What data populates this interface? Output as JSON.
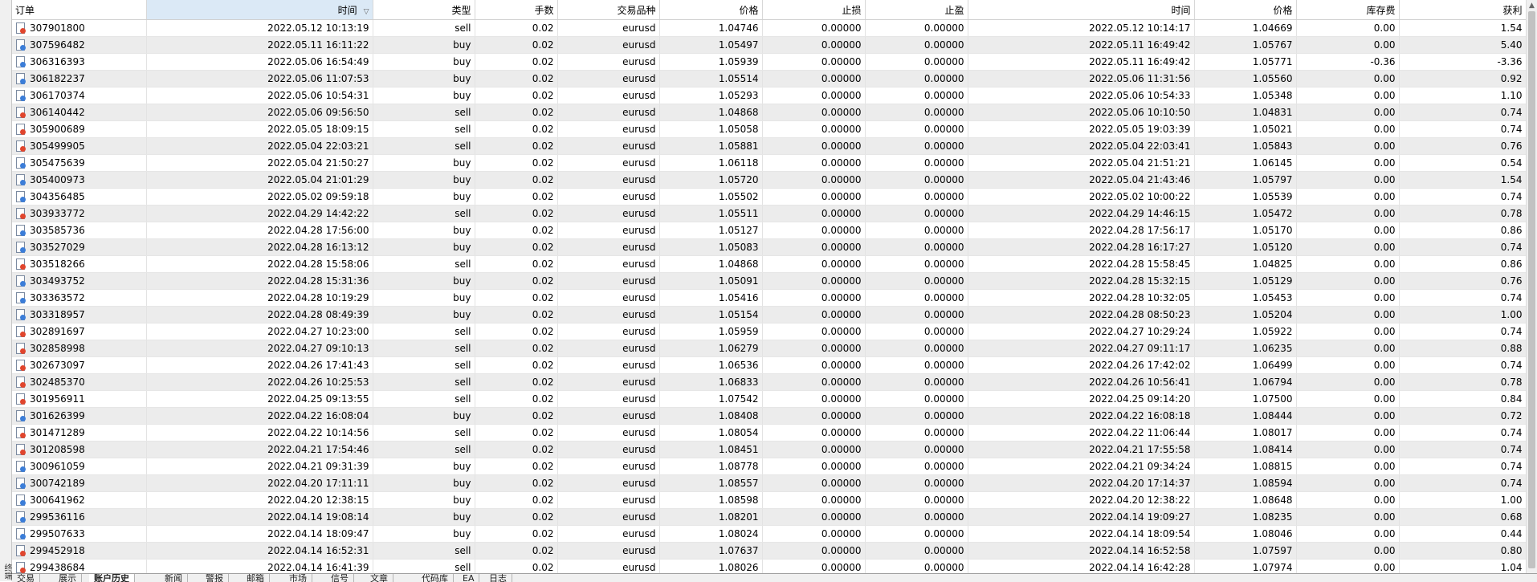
{
  "leftstrip_label": "终端",
  "columns": [
    {
      "key": "order",
      "label": "订单",
      "align": "l"
    },
    {
      "key": "open_time",
      "label": "时间",
      "align": "r",
      "sorted": true
    },
    {
      "key": "type",
      "label": "类型",
      "align": "r"
    },
    {
      "key": "volume",
      "label": "手数",
      "align": "r"
    },
    {
      "key": "symbol",
      "label": "交易品种",
      "align": "r"
    },
    {
      "key": "open_price",
      "label": "价格",
      "align": "r"
    },
    {
      "key": "sl",
      "label": "止损",
      "align": "r"
    },
    {
      "key": "tp",
      "label": "止盈",
      "align": "r"
    },
    {
      "key": "close_time",
      "label": "时间",
      "align": "r"
    },
    {
      "key": "close_price",
      "label": "价格",
      "align": "r"
    },
    {
      "key": "swap",
      "label": "库存费",
      "align": "r"
    },
    {
      "key": "profit",
      "label": "获利",
      "align": "r"
    }
  ],
  "sort_icon": "▽",
  "rows": [
    {
      "icon": "sell",
      "order": "307901800",
      "open_time": "2022.05.12 10:13:19",
      "type": "sell",
      "volume": "0.02",
      "symbol": "eurusd",
      "open_price": "1.04746",
      "sl": "0.00000",
      "tp": "0.00000",
      "close_time": "2022.05.12 10:14:17",
      "close_price": "1.04669",
      "swap": "0.00",
      "profit": "1.54"
    },
    {
      "icon": "buy",
      "order": "307596482",
      "open_time": "2022.05.11 16:11:22",
      "type": "buy",
      "volume": "0.02",
      "symbol": "eurusd",
      "open_price": "1.05497",
      "sl": "0.00000",
      "tp": "0.00000",
      "close_time": "2022.05.11 16:49:42",
      "close_price": "1.05767",
      "swap": "0.00",
      "profit": "5.40"
    },
    {
      "icon": "buy",
      "order": "306316393",
      "open_time": "2022.05.06 16:54:49",
      "type": "buy",
      "volume": "0.02",
      "symbol": "eurusd",
      "open_price": "1.05939",
      "sl": "0.00000",
      "tp": "0.00000",
      "close_time": "2022.05.11 16:49:42",
      "close_price": "1.05771",
      "swap": "-0.36",
      "profit": "-3.36"
    },
    {
      "icon": "buy",
      "order": "306182237",
      "open_time": "2022.05.06 11:07:53",
      "type": "buy",
      "volume": "0.02",
      "symbol": "eurusd",
      "open_price": "1.05514",
      "sl": "0.00000",
      "tp": "0.00000",
      "close_time": "2022.05.06 11:31:56",
      "close_price": "1.05560",
      "swap": "0.00",
      "profit": "0.92"
    },
    {
      "icon": "buy",
      "order": "306170374",
      "open_time": "2022.05.06 10:54:31",
      "type": "buy",
      "volume": "0.02",
      "symbol": "eurusd",
      "open_price": "1.05293",
      "sl": "0.00000",
      "tp": "0.00000",
      "close_time": "2022.05.06 10:54:33",
      "close_price": "1.05348",
      "swap": "0.00",
      "profit": "1.10"
    },
    {
      "icon": "sell",
      "order": "306140442",
      "open_time": "2022.05.06 09:56:50",
      "type": "sell",
      "volume": "0.02",
      "symbol": "eurusd",
      "open_price": "1.04868",
      "sl": "0.00000",
      "tp": "0.00000",
      "close_time": "2022.05.06 10:10:50",
      "close_price": "1.04831",
      "swap": "0.00",
      "profit": "0.74"
    },
    {
      "icon": "sell",
      "order": "305900689",
      "open_time": "2022.05.05 18:09:15",
      "type": "sell",
      "volume": "0.02",
      "symbol": "eurusd",
      "open_price": "1.05058",
      "sl": "0.00000",
      "tp": "0.00000",
      "close_time": "2022.05.05 19:03:39",
      "close_price": "1.05021",
      "swap": "0.00",
      "profit": "0.74"
    },
    {
      "icon": "sell",
      "order": "305499905",
      "open_time": "2022.05.04 22:03:21",
      "type": "sell",
      "volume": "0.02",
      "symbol": "eurusd",
      "open_price": "1.05881",
      "sl": "0.00000",
      "tp": "0.00000",
      "close_time": "2022.05.04 22:03:41",
      "close_price": "1.05843",
      "swap": "0.00",
      "profit": "0.76"
    },
    {
      "icon": "buy",
      "order": "305475639",
      "open_time": "2022.05.04 21:50:27",
      "type": "buy",
      "volume": "0.02",
      "symbol": "eurusd",
      "open_price": "1.06118",
      "sl": "0.00000",
      "tp": "0.00000",
      "close_time": "2022.05.04 21:51:21",
      "close_price": "1.06145",
      "swap": "0.00",
      "profit": "0.54"
    },
    {
      "icon": "buy",
      "order": "305400973",
      "open_time": "2022.05.04 21:01:29",
      "type": "buy",
      "volume": "0.02",
      "symbol": "eurusd",
      "open_price": "1.05720",
      "sl": "0.00000",
      "tp": "0.00000",
      "close_time": "2022.05.04 21:43:46",
      "close_price": "1.05797",
      "swap": "0.00",
      "profit": "1.54"
    },
    {
      "icon": "buy",
      "order": "304356485",
      "open_time": "2022.05.02 09:59:18",
      "type": "buy",
      "volume": "0.02",
      "symbol": "eurusd",
      "open_price": "1.05502",
      "sl": "0.00000",
      "tp": "0.00000",
      "close_time": "2022.05.02 10:00:22",
      "close_price": "1.05539",
      "swap": "0.00",
      "profit": "0.74"
    },
    {
      "icon": "sell",
      "order": "303933772",
      "open_time": "2022.04.29 14:42:22",
      "type": "sell",
      "volume": "0.02",
      "symbol": "eurusd",
      "open_price": "1.05511",
      "sl": "0.00000",
      "tp": "0.00000",
      "close_time": "2022.04.29 14:46:15",
      "close_price": "1.05472",
      "swap": "0.00",
      "profit": "0.78"
    },
    {
      "icon": "buy",
      "order": "303585736",
      "open_time": "2022.04.28 17:56:00",
      "type": "buy",
      "volume": "0.02",
      "symbol": "eurusd",
      "open_price": "1.05127",
      "sl": "0.00000",
      "tp": "0.00000",
      "close_time": "2022.04.28 17:56:17",
      "close_price": "1.05170",
      "swap": "0.00",
      "profit": "0.86"
    },
    {
      "icon": "buy",
      "order": "303527029",
      "open_time": "2022.04.28 16:13:12",
      "type": "buy",
      "volume": "0.02",
      "symbol": "eurusd",
      "open_price": "1.05083",
      "sl": "0.00000",
      "tp": "0.00000",
      "close_time": "2022.04.28 16:17:27",
      "close_price": "1.05120",
      "swap": "0.00",
      "profit": "0.74"
    },
    {
      "icon": "sell",
      "order": "303518266",
      "open_time": "2022.04.28 15:58:06",
      "type": "sell",
      "volume": "0.02",
      "symbol": "eurusd",
      "open_price": "1.04868",
      "sl": "0.00000",
      "tp": "0.00000",
      "close_time": "2022.04.28 15:58:45",
      "close_price": "1.04825",
      "swap": "0.00",
      "profit": "0.86"
    },
    {
      "icon": "buy",
      "order": "303493752",
      "open_time": "2022.04.28 15:31:36",
      "type": "buy",
      "volume": "0.02",
      "symbol": "eurusd",
      "open_price": "1.05091",
      "sl": "0.00000",
      "tp": "0.00000",
      "close_time": "2022.04.28 15:32:15",
      "close_price": "1.05129",
      "swap": "0.00",
      "profit": "0.76"
    },
    {
      "icon": "buy",
      "order": "303363572",
      "open_time": "2022.04.28 10:19:29",
      "type": "buy",
      "volume": "0.02",
      "symbol": "eurusd",
      "open_price": "1.05416",
      "sl": "0.00000",
      "tp": "0.00000",
      "close_time": "2022.04.28 10:32:05",
      "close_price": "1.05453",
      "swap": "0.00",
      "profit": "0.74"
    },
    {
      "icon": "buy",
      "order": "303318957",
      "open_time": "2022.04.28 08:49:39",
      "type": "buy",
      "volume": "0.02",
      "symbol": "eurusd",
      "open_price": "1.05154",
      "sl": "0.00000",
      "tp": "0.00000",
      "close_time": "2022.04.28 08:50:23",
      "close_price": "1.05204",
      "swap": "0.00",
      "profit": "1.00"
    },
    {
      "icon": "sell",
      "order": "302891697",
      "open_time": "2022.04.27 10:23:00",
      "type": "sell",
      "volume": "0.02",
      "symbol": "eurusd",
      "open_price": "1.05959",
      "sl": "0.00000",
      "tp": "0.00000",
      "close_time": "2022.04.27 10:29:24",
      "close_price": "1.05922",
      "swap": "0.00",
      "profit": "0.74"
    },
    {
      "icon": "sell",
      "order": "302858998",
      "open_time": "2022.04.27 09:10:13",
      "type": "sell",
      "volume": "0.02",
      "symbol": "eurusd",
      "open_price": "1.06279",
      "sl": "0.00000",
      "tp": "0.00000",
      "close_time": "2022.04.27 09:11:17",
      "close_price": "1.06235",
      "swap": "0.00",
      "profit": "0.88"
    },
    {
      "icon": "sell",
      "order": "302673097",
      "open_time": "2022.04.26 17:41:43",
      "type": "sell",
      "volume": "0.02",
      "symbol": "eurusd",
      "open_price": "1.06536",
      "sl": "0.00000",
      "tp": "0.00000",
      "close_time": "2022.04.26 17:42:02",
      "close_price": "1.06499",
      "swap": "0.00",
      "profit": "0.74"
    },
    {
      "icon": "sell",
      "order": "302485370",
      "open_time": "2022.04.26 10:25:53",
      "type": "sell",
      "volume": "0.02",
      "symbol": "eurusd",
      "open_price": "1.06833",
      "sl": "0.00000",
      "tp": "0.00000",
      "close_time": "2022.04.26 10:56:41",
      "close_price": "1.06794",
      "swap": "0.00",
      "profit": "0.78"
    },
    {
      "icon": "sell",
      "order": "301956911",
      "open_time": "2022.04.25 09:13:55",
      "type": "sell",
      "volume": "0.02",
      "symbol": "eurusd",
      "open_price": "1.07542",
      "sl": "0.00000",
      "tp": "0.00000",
      "close_time": "2022.04.25 09:14:20",
      "close_price": "1.07500",
      "swap": "0.00",
      "profit": "0.84"
    },
    {
      "icon": "buy",
      "order": "301626399",
      "open_time": "2022.04.22 16:08:04",
      "type": "buy",
      "volume": "0.02",
      "symbol": "eurusd",
      "open_price": "1.08408",
      "sl": "0.00000",
      "tp": "0.00000",
      "close_time": "2022.04.22 16:08:18",
      "close_price": "1.08444",
      "swap": "0.00",
      "profit": "0.72"
    },
    {
      "icon": "sell",
      "order": "301471289",
      "open_time": "2022.04.22 10:14:56",
      "type": "sell",
      "volume": "0.02",
      "symbol": "eurusd",
      "open_price": "1.08054",
      "sl": "0.00000",
      "tp": "0.00000",
      "close_time": "2022.04.22 11:06:44",
      "close_price": "1.08017",
      "swap": "0.00",
      "profit": "0.74"
    },
    {
      "icon": "sell",
      "order": "301208598",
      "open_time": "2022.04.21 17:54:46",
      "type": "sell",
      "volume": "0.02",
      "symbol": "eurusd",
      "open_price": "1.08451",
      "sl": "0.00000",
      "tp": "0.00000",
      "close_time": "2022.04.21 17:55:58",
      "close_price": "1.08414",
      "swap": "0.00",
      "profit": "0.74"
    },
    {
      "icon": "buy",
      "order": "300961059",
      "open_time": "2022.04.21 09:31:39",
      "type": "buy",
      "volume": "0.02",
      "symbol": "eurusd",
      "open_price": "1.08778",
      "sl": "0.00000",
      "tp": "0.00000",
      "close_time": "2022.04.21 09:34:24",
      "close_price": "1.08815",
      "swap": "0.00",
      "profit": "0.74"
    },
    {
      "icon": "buy",
      "order": "300742189",
      "open_time": "2022.04.20 17:11:11",
      "type": "buy",
      "volume": "0.02",
      "symbol": "eurusd",
      "open_price": "1.08557",
      "sl": "0.00000",
      "tp": "0.00000",
      "close_time": "2022.04.20 17:14:37",
      "close_price": "1.08594",
      "swap": "0.00",
      "profit": "0.74"
    },
    {
      "icon": "buy",
      "order": "300641962",
      "open_time": "2022.04.20 12:38:15",
      "type": "buy",
      "volume": "0.02",
      "symbol": "eurusd",
      "open_price": "1.08598",
      "sl": "0.00000",
      "tp": "0.00000",
      "close_time": "2022.04.20 12:38:22",
      "close_price": "1.08648",
      "swap": "0.00",
      "profit": "1.00"
    },
    {
      "icon": "buy",
      "order": "299536116",
      "open_time": "2022.04.14 19:08:14",
      "type": "buy",
      "volume": "0.02",
      "symbol": "eurusd",
      "open_price": "1.08201",
      "sl": "0.00000",
      "tp": "0.00000",
      "close_time": "2022.04.14 19:09:27",
      "close_price": "1.08235",
      "swap": "0.00",
      "profit": "0.68"
    },
    {
      "icon": "buy",
      "order": "299507633",
      "open_time": "2022.04.14 18:09:47",
      "type": "buy",
      "volume": "0.02",
      "symbol": "eurusd",
      "open_price": "1.08024",
      "sl": "0.00000",
      "tp": "0.00000",
      "close_time": "2022.04.14 18:09:54",
      "close_price": "1.08046",
      "swap": "0.00",
      "profit": "0.44"
    },
    {
      "icon": "sell",
      "order": "299452918",
      "open_time": "2022.04.14 16:52:31",
      "type": "sell",
      "volume": "0.02",
      "symbol": "eurusd",
      "open_price": "1.07637",
      "sl": "0.00000",
      "tp": "0.00000",
      "close_time": "2022.04.14 16:52:58",
      "close_price": "1.07597",
      "swap": "0.00",
      "profit": "0.80"
    },
    {
      "icon": "sell",
      "order": "299438684",
      "open_time": "2022.04.14 16:41:39",
      "type": "sell",
      "volume": "0.02",
      "symbol": "eurusd",
      "open_price": "1.08026",
      "sl": "0.00000",
      "tp": "0.00000",
      "close_time": "2022.04.14 16:42:28",
      "close_price": "1.07974",
      "swap": "0.00",
      "profit": "1.04"
    }
  ],
  "icon_colors": {
    "buy": "#3b7dd8",
    "sell": "#e0452d"
  },
  "tabs": [
    {
      "label": "交易",
      "active": false
    },
    {
      "label": "展示",
      "active": false
    },
    {
      "label": "账户历史",
      "active": true
    },
    {
      "label": "新闻",
      "active": false
    },
    {
      "label": "警报",
      "active": false
    },
    {
      "label": "邮箱",
      "active": false
    },
    {
      "label": "市场",
      "active": false
    },
    {
      "label": "信号",
      "active": false
    },
    {
      "label": "文章",
      "active": false
    },
    {
      "label": "代码库",
      "active": false
    },
    {
      "label": "EA",
      "active": false
    },
    {
      "label": "日志",
      "active": false
    }
  ]
}
